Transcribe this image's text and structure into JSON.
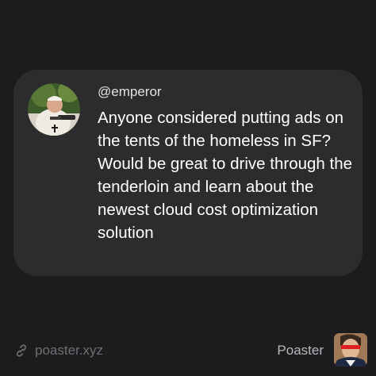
{
  "post": {
    "handle": "@emperor",
    "text": "Anyone considered putting ads on the tents of the homeless in SF? Would be great to drive through the tenderloin and learn about the newest cloud cost optimization solution",
    "avatar_icon": "user-avatar-photo"
  },
  "footer": {
    "link_icon": "link-icon",
    "link_text": "poaster.xyz",
    "brand_name": "Poaster",
    "brand_icon": "poaster-logo-avatar"
  },
  "colors": {
    "background": "#1c1c1e",
    "card": "#2c2c2e",
    "text_primary": "#ffffff",
    "text_secondary": "#e2e2e4",
    "footer_text": "#6f6f73"
  }
}
